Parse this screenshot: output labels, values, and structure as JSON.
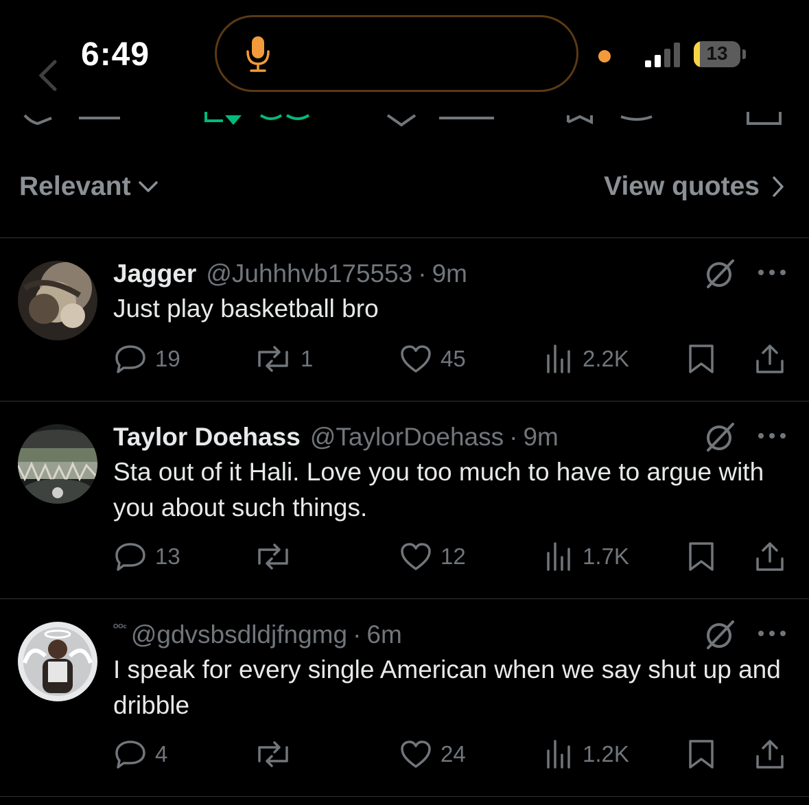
{
  "status_bar": {
    "time": "6:49",
    "battery_level": "13",
    "battery_fraction": 0.13,
    "icons": [
      "microphone-icon",
      "privacy-indicator-dot",
      "cellular-signal-icon",
      "battery-icon"
    ]
  },
  "sort_bar": {
    "sort_label": "Relevant",
    "view_quotes_label": "View quotes"
  },
  "colors": {
    "background": "#000000",
    "text_primary": "#e7e9ea",
    "text_secondary": "#71767b",
    "divider": "#2f3336",
    "repost_green": "#00ba7c",
    "mic_orange": "#f39b3a",
    "battery_yellow": "#f5d547"
  },
  "replies": [
    {
      "name": "Jagger",
      "handle": "@Juhhhvb175553",
      "separator": "·",
      "time": "9m",
      "text": "Just play basketball bro",
      "replies": "19",
      "reposts": "1",
      "likes": "45",
      "views": "2.2K"
    },
    {
      "name": "Taylor Doehass",
      "handle": "@TaylorDoehass",
      "separator": "·",
      "time": "9m",
      "text": "Sta out of it Hali. Love you too much to have to argue with you about such things.",
      "replies": "13",
      "reposts": "",
      "likes": "12",
      "views": "1.7K"
    },
    {
      "name": "",
      "badge": "ᴼᴼᶜ",
      "handle": "@gdvsbsdldjfngmg",
      "separator": "·",
      "time": "6m",
      "text": "I speak for every single American when we say shut up and dribble",
      "replies": "4",
      "reposts": "",
      "likes": "24",
      "views": "1.2K"
    }
  ]
}
